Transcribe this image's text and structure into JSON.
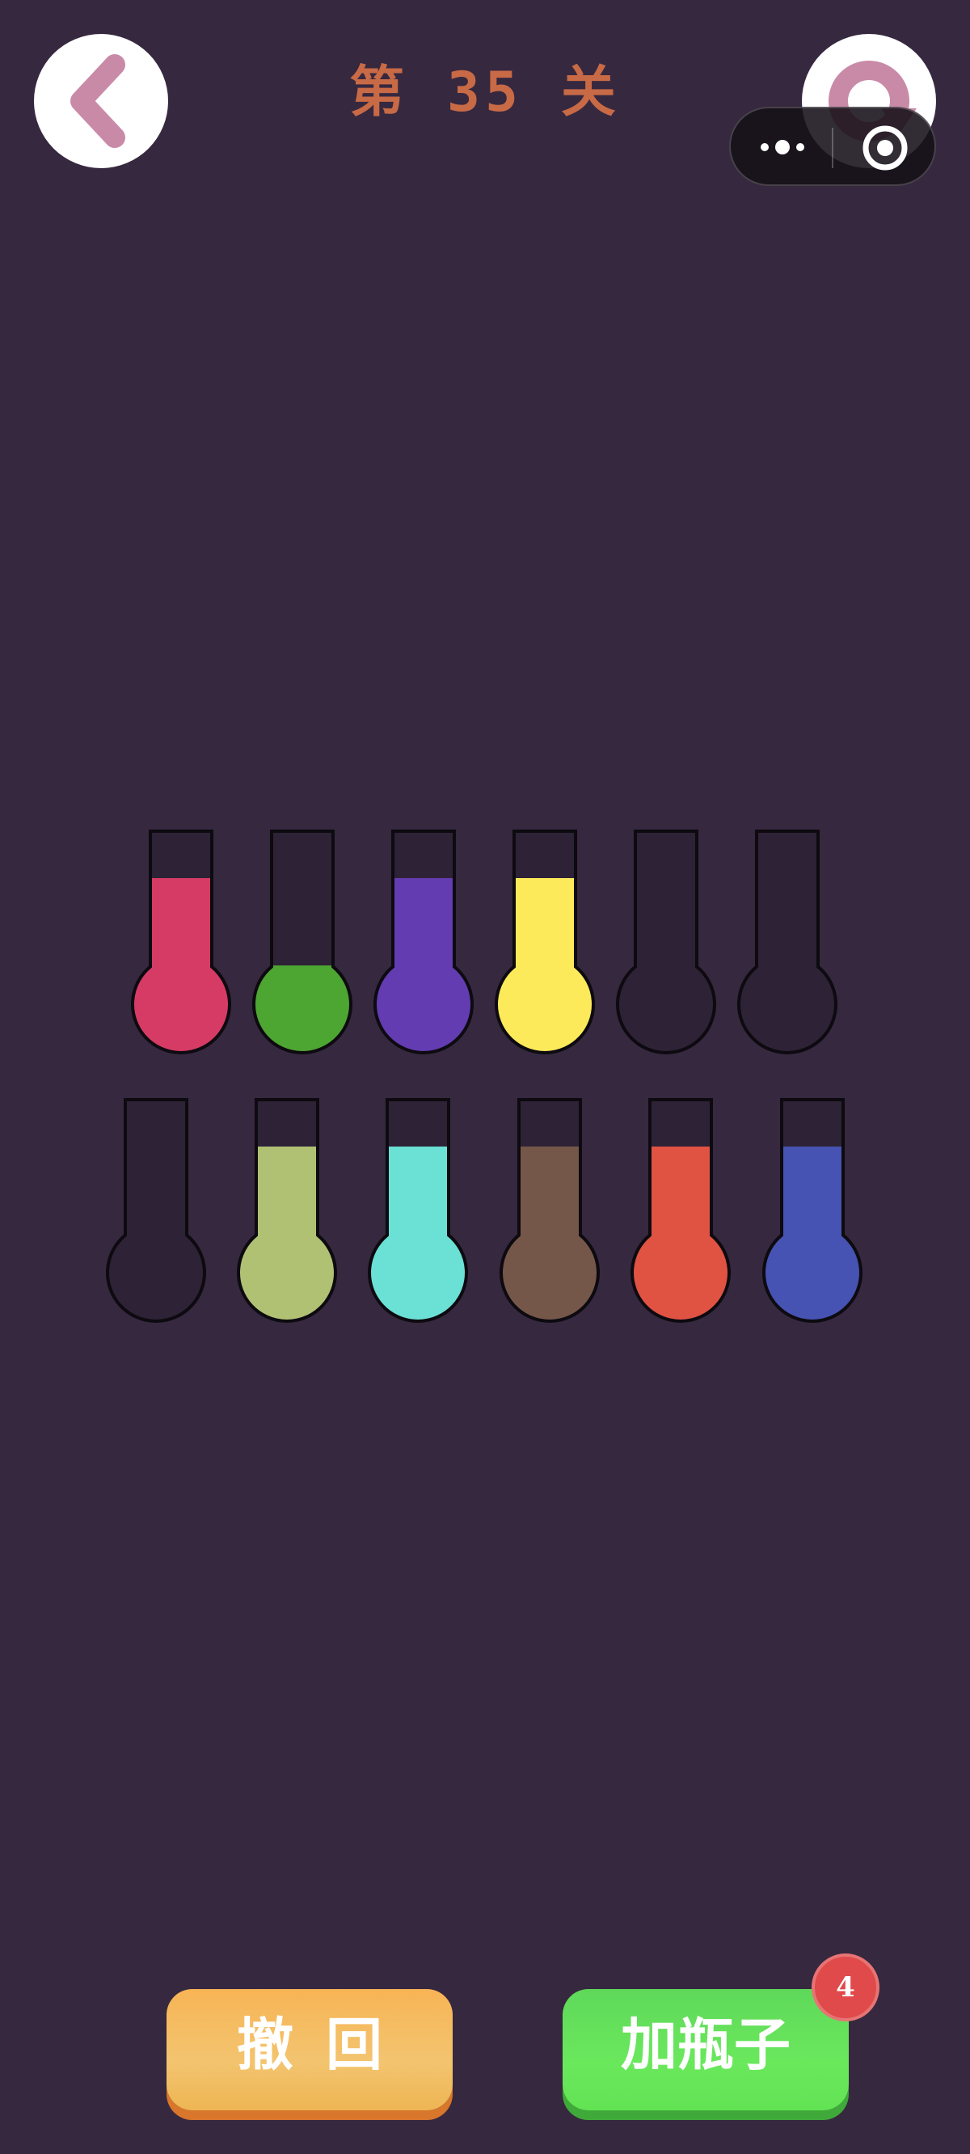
{
  "header": {
    "level_title": "第 35 关",
    "back_icon": "chevron-left-icon",
    "restart_icon": "restart-icon"
  },
  "capsule": {
    "more_icon": "more-dots-icon",
    "close_icon": "close-target-icon"
  },
  "tubes": {
    "rows": [
      [
        {
          "color": "#d63b66",
          "fill": 0.8
        },
        {
          "color": "#4da532",
          "fill": 0.4
        },
        {
          "color": "#633cb1",
          "fill": 0.8
        },
        {
          "color": "#fdea5a",
          "fill": 0.8
        },
        {
          "color": null,
          "fill": 0
        },
        {
          "color": null,
          "fill": 0
        }
      ],
      [
        {
          "color": null,
          "fill": 0
        },
        {
          "color": "#b0c174",
          "fill": 0.8
        },
        {
          "color": "#6be0d5",
          "fill": 0.8
        },
        {
          "color": "#75574a",
          "fill": 0.8
        },
        {
          "color": "#e05343",
          "fill": 0.8
        },
        {
          "color": "#4653b2",
          "fill": 0.8
        }
      ]
    ]
  },
  "actions": {
    "undo_label": "撤回",
    "add_bottle_label": "加瓶子",
    "add_bottle_count": "4"
  },
  "colors": {
    "background": "#36283f",
    "title": "#c86a46",
    "accent_icon": "#c98aa8"
  }
}
